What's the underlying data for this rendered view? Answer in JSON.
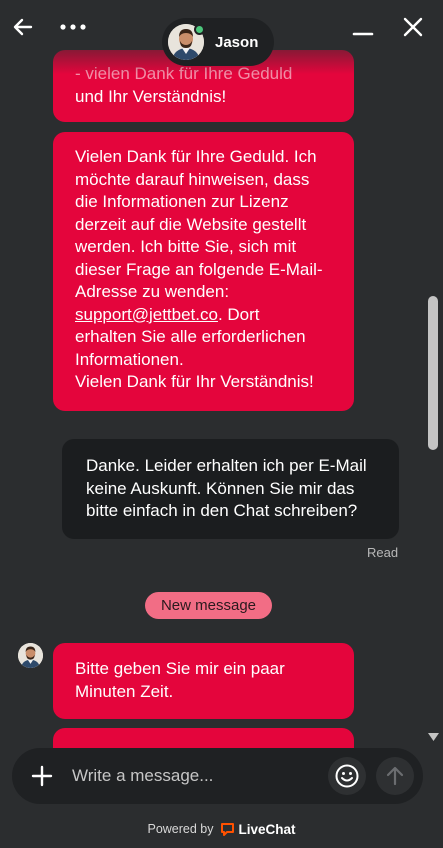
{
  "header": {
    "agent_name": "Jason",
    "online_color": "#4cc77c",
    "icons": {
      "back": "arrow-left-icon",
      "more": "more-dots-icon",
      "minimize": "minimize-icon",
      "close": "close-icon"
    }
  },
  "messages": {
    "agent_msg_1": {
      "line1": "- vielen Dank für Ihre Geduld",
      "line2": "und Ihr Verständnis!"
    },
    "agent_msg_2": {
      "lines": [
        "Vielen Dank für Ihre Geduld. Ich",
        "möchte darauf hinweisen, dass",
        "die Informationen zur Lizenz",
        "derzeit auf die Website gestellt",
        "werden. Ich bitte Sie, sich mit",
        "dieser Frage an folgende E-Mail-",
        "Adresse zu wenden:"
      ],
      "email": "support@jettbet.co",
      "after_email": ". Dort",
      "tail_lines": [
        "erhalten Sie alle erforderlichen",
        "Informationen.",
        "Vielen Dank für Ihr Verständnis!"
      ]
    },
    "user_msg_1": {
      "lines": [
        "Danke. Leider erhalten ich per E-Mail",
        "keine Auskunft. Können Sie mir das",
        "bitte einfach in den Chat schreiben?"
      ]
    },
    "read_status": "Read",
    "new_message_label": "New message",
    "agent_msg_3": {
      "lines": [
        "Bitte geben Sie mir ein paar",
        "Minuten Zeit."
      ]
    }
  },
  "composer": {
    "placeholder": "Write a message...",
    "icons": {
      "add": "plus-icon",
      "emoji": "smiley-icon",
      "send": "arrow-up-icon"
    }
  },
  "footer": {
    "powered_by": "Powered by",
    "brand": "LiveChat",
    "brand_color": "#ff5100"
  },
  "colors": {
    "background": "#2b2d2f",
    "agent_bubble": "#e4053c",
    "user_bubble": "#1b1d1f",
    "new_message_pill": "#f26d85"
  }
}
